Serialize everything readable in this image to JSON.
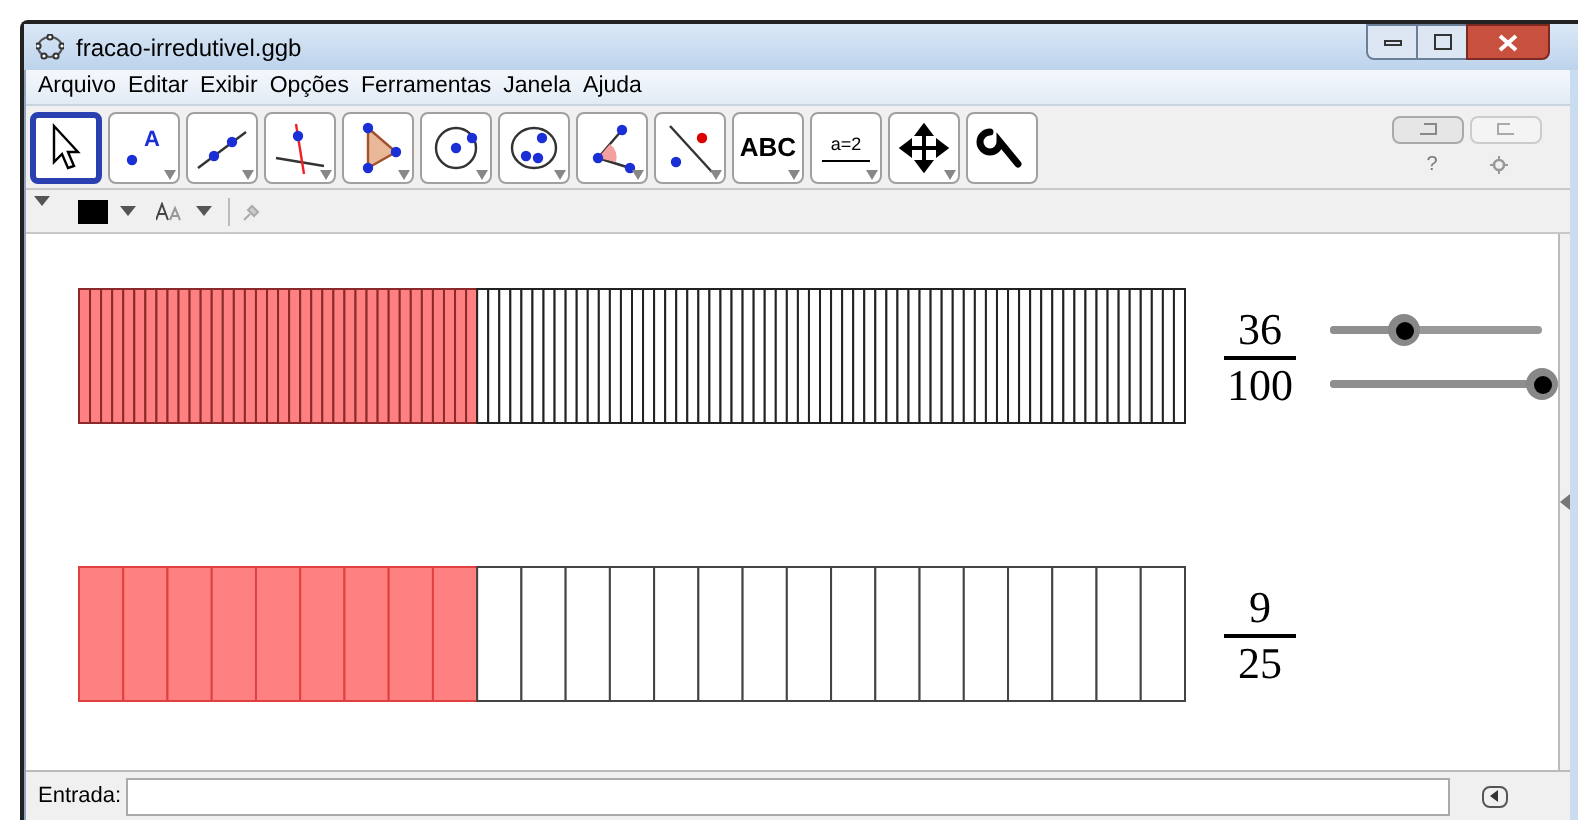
{
  "window": {
    "title": "fracao-irredutivel.ggb"
  },
  "menu": [
    "Arquivo",
    "Editar",
    "Exibir",
    "Opções",
    "Ferramentas",
    "Janela",
    "Ajuda"
  ],
  "tools": [
    {
      "kind": "pointer",
      "selected": true
    },
    {
      "kind": "point",
      "label": "A",
      "selected": false
    },
    {
      "kind": "line",
      "selected": false
    },
    {
      "kind": "perpendicular",
      "selected": false
    },
    {
      "kind": "polygon",
      "selected": false
    },
    {
      "kind": "circle",
      "selected": false
    },
    {
      "kind": "conic",
      "selected": false
    },
    {
      "kind": "angle",
      "selected": false
    },
    {
      "kind": "reflect",
      "selected": false
    },
    {
      "kind": "text",
      "label": "ABC",
      "selected": false
    },
    {
      "kind": "slider",
      "label": "a=2",
      "selected": false
    },
    {
      "kind": "pan",
      "selected": false
    },
    {
      "kind": "wrench",
      "selected": false
    }
  ],
  "help": "?",
  "bars": [
    {
      "numerator": "36",
      "denominator": "100",
      "sliders": [
        {
          "level": 0.35
        },
        {
          "level": 1
        }
      ]
    },
    {
      "numerator": "9",
      "denominator": "25"
    }
  ],
  "input_bar": {
    "label": "Entrada:"
  }
}
